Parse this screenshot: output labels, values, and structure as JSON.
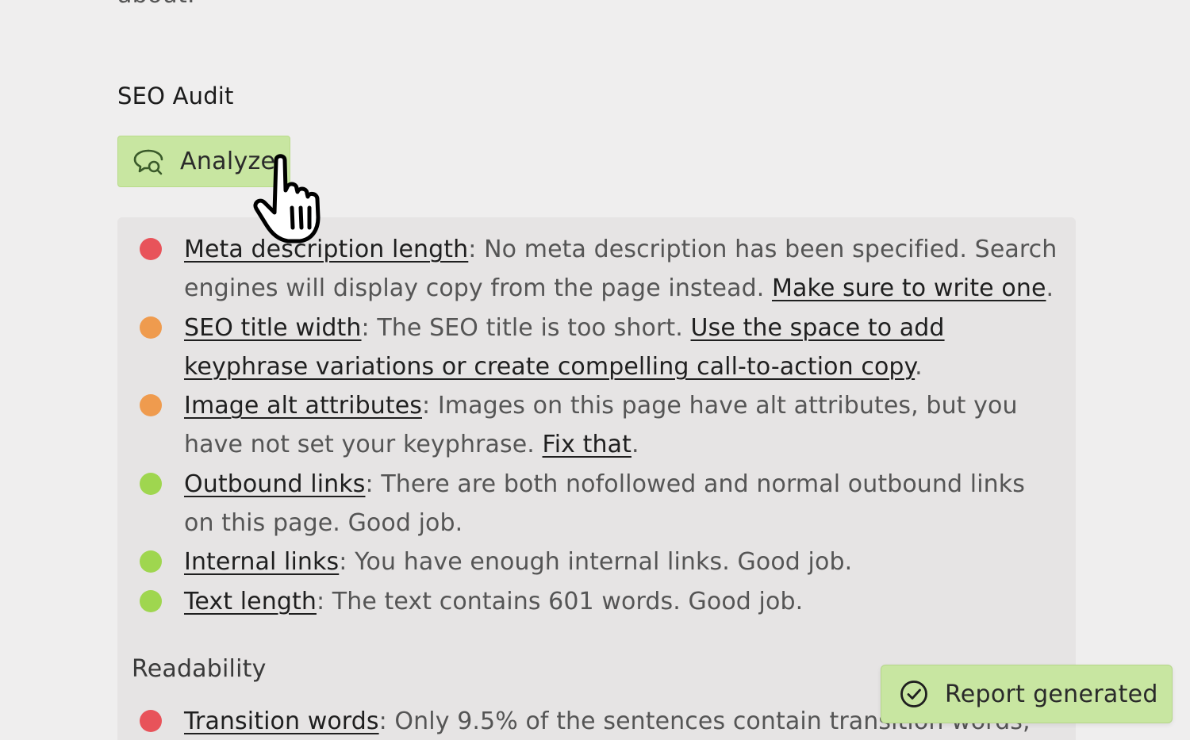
{
  "top_fragment": "about.",
  "seo_audit": {
    "title": "SEO Audit",
    "analyze_button": {
      "label": "Analyze",
      "icon": "chat-search-icon"
    },
    "results": [
      {
        "status": "bad",
        "color": "#e8535a",
        "parts": [
          {
            "t": "Meta description length",
            "link": true
          },
          {
            "t": ": No meta description has been specified. Search engines will display copy from the page instead. "
          },
          {
            "t": "Make sure to write one",
            "link": true
          },
          {
            "t": "."
          }
        ]
      },
      {
        "status": "ok",
        "color": "#ef9b4e",
        "parts": [
          {
            "t": "SEO title width",
            "link": true
          },
          {
            "t": ": The SEO title is too short. "
          },
          {
            "t": "Use the space to add keyphrase variations or create compelling call-to-action copy",
            "link": true
          },
          {
            "t": "."
          }
        ]
      },
      {
        "status": "ok",
        "color": "#ef9b4e",
        "parts": [
          {
            "t": "Image alt attributes",
            "link": true
          },
          {
            "t": ": Images on this page have alt attributes, but you have not set your keyphrase. "
          },
          {
            "t": "Fix that",
            "link": true
          },
          {
            "t": "."
          }
        ]
      },
      {
        "status": "good",
        "color": "#9fd64f",
        "parts": [
          {
            "t": "Outbound links",
            "link": true
          },
          {
            "t": ": There are both nofollowed and normal outbound links on this page. Good job."
          }
        ]
      },
      {
        "status": "good",
        "color": "#9fd64f",
        "parts": [
          {
            "t": "Internal links",
            "link": true
          },
          {
            "t": ": You have enough internal links. Good job."
          }
        ]
      },
      {
        "status": "good",
        "color": "#9fd64f",
        "parts": [
          {
            "t": "Text length",
            "link": true
          },
          {
            "t": ": The text contains 601 words. Good job."
          }
        ]
      }
    ]
  },
  "readability": {
    "title": "Readability",
    "results": [
      {
        "status": "bad",
        "color": "#e8535a",
        "parts": [
          {
            "t": "Transition words",
            "link": true
          },
          {
            "t": ": Only 9.5% of the sentences contain transition words,"
          }
        ]
      }
    ]
  },
  "toast": {
    "label": "Report generated",
    "icon": "check-circle-icon"
  },
  "cursor": {
    "icon": "hand-pointer-icon"
  }
}
